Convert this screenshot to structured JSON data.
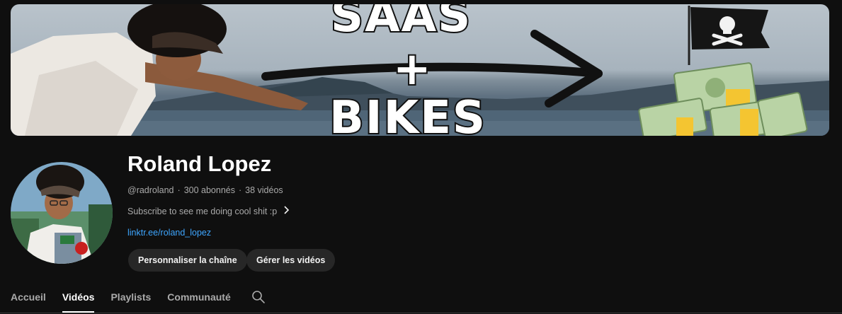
{
  "banner": {
    "line1": "SAAS",
    "line2": "+",
    "line3": "BIKES"
  },
  "channel": {
    "name": "Roland Lopez",
    "handle": "@radroland",
    "subscribers": "300 abonnés",
    "videos": "38 vidéos",
    "separator": "·",
    "description": "Subscribe to see me doing cool shit :p",
    "link": "linktr.ee/roland_lopez"
  },
  "buttons": {
    "customize": "Personnaliser la chaîne",
    "manage": "Gérer les vidéos"
  },
  "tabs": [
    {
      "label": "Accueil",
      "active": false
    },
    {
      "label": "Vidéos",
      "active": true
    },
    {
      "label": "Playlists",
      "active": false
    },
    {
      "label": "Communauté",
      "active": false
    }
  ],
  "icons": {
    "search": "search-icon",
    "chevron": "chevron-right-icon",
    "flag": "pirate-flag-icon",
    "money": "money-stack-icon"
  },
  "colors": {
    "background": "#0f0f0f",
    "link": "#3ea6ff",
    "button_bg": "#272727",
    "muted_text": "#aaaaaa"
  }
}
